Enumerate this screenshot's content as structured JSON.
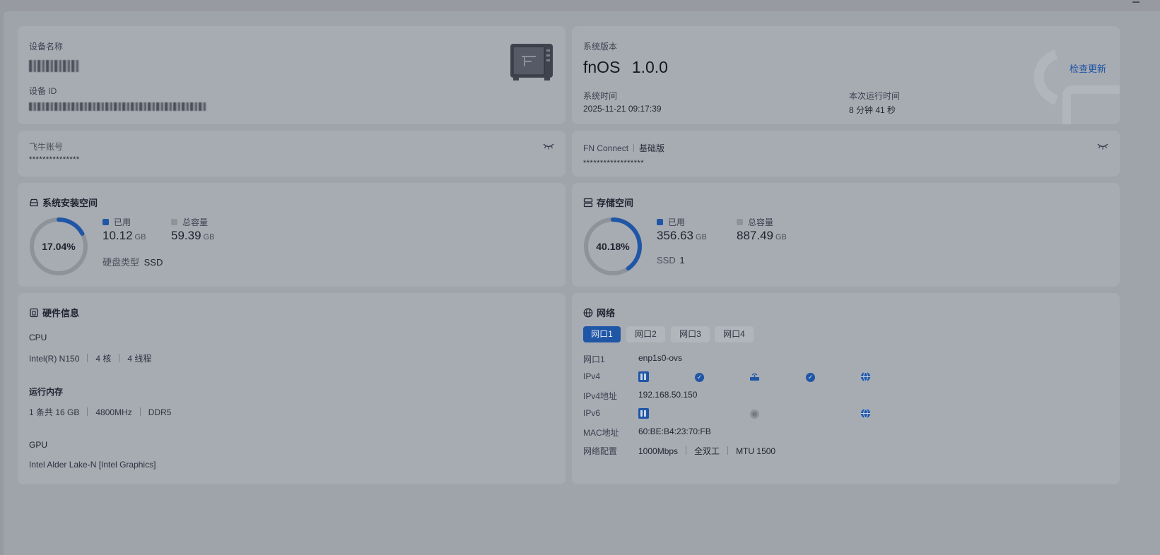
{
  "device": {
    "name_label": "设备名称",
    "id_label": "设备 ID"
  },
  "system": {
    "version_label": "系统版本",
    "version": "fnOS",
    "version_number": "1.0.0",
    "check_update": "检查更新",
    "time_label": "系统时间",
    "time_value": "2025-11-21 09:17:39",
    "uptime_label": "本次运行时间",
    "uptime_value": "8 分钟 41 秒"
  },
  "account": {
    "label": "飞牛账号",
    "value": "***************"
  },
  "fn_connect": {
    "label": "FN Connect",
    "plan": "基础版",
    "value": "******************"
  },
  "system_storage": {
    "title": "系统安装空间",
    "percent": "17.04%",
    "percent_value": 17.04,
    "used_label": "已用",
    "used_value": "10.12",
    "used_unit": "GB",
    "total_label": "总容量",
    "total_value": "59.39",
    "total_unit": "GB",
    "disk_type_label": "硬盘类型",
    "disk_type_value": "SSD"
  },
  "storage": {
    "title": "存储空间",
    "percent": "40.18%",
    "percent_value": 40.18,
    "used_label": "已用",
    "used_value": "356.63",
    "used_unit": "GB",
    "total_label": "总容量",
    "total_value": "887.49",
    "total_unit": "GB",
    "ssd_label": "SSD",
    "ssd_count": "1"
  },
  "hardware": {
    "title": "硬件信息",
    "cpu_label": "CPU",
    "cpu_model": "Intel(R) N150",
    "cpu_cores": "4 核",
    "cpu_threads": "4 线程",
    "mem_label": "运行内存",
    "mem_size": "1 条共 16 GB",
    "mem_speed": "4800MHz",
    "mem_type": "DDR5",
    "gpu_label": "GPU",
    "gpu_model": "Intel Alder Lake-N [Intel Graphics]"
  },
  "network": {
    "title": "网络",
    "tabs": [
      "网口1",
      "网口2",
      "网口3",
      "网口4"
    ],
    "port_label": "网口1",
    "port_value": "enp1s0-ovs",
    "ipv4_label": "IPv4",
    "ipv4_addr_label": "IPv4地址",
    "ipv4_addr_value": "192.168.50.150",
    "ipv6_label": "IPv6",
    "mac_label": "MAC地址",
    "mac_value": "60:BE:B4:23:70:FB",
    "config_label": "网络配置",
    "speed": "1000Mbps",
    "duplex": "全双工",
    "mtu": "MTU 1500"
  },
  "colors": {
    "accent": "#1f56a6",
    "ring_track": "#8e929a",
    "legend_total": "#8e929a"
  }
}
